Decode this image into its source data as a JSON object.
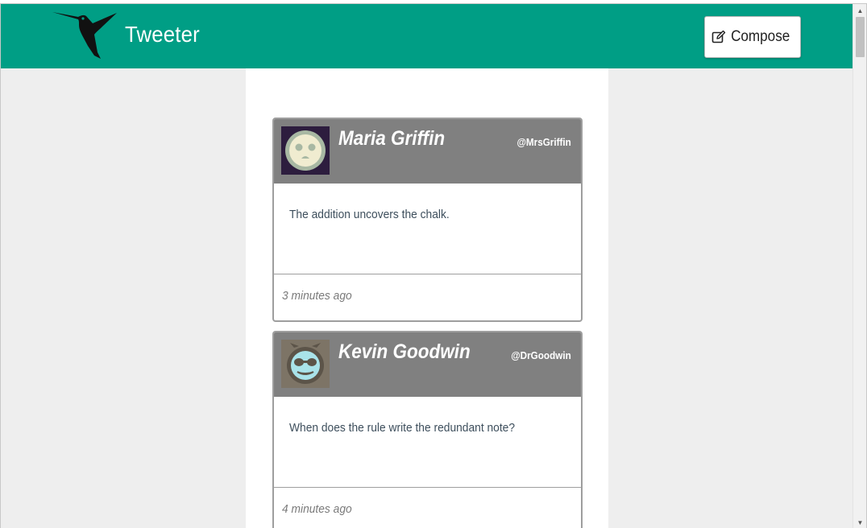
{
  "header": {
    "brand": "Tweeter",
    "compose_label": "Compose",
    "logo_icon": "hummingbird-icon",
    "compose_icon": "edit-icon"
  },
  "colors": {
    "navbar": "#009e85",
    "tweet_header": "#808080",
    "background": "#eeeeee"
  },
  "tweets": [
    {
      "name": "Maria Griffin",
      "handle": "@MrsGriffin",
      "content": "The addition uncovers the chalk.",
      "time": "3 minutes ago",
      "avatar_icon": "avatar-face-icon"
    },
    {
      "name": "Kevin Goodwin",
      "handle": "@DrGoodwin",
      "content": "When does the rule write the redundant note?",
      "time": "4 minutes ago",
      "avatar_icon": "avatar-goggles-icon"
    }
  ]
}
